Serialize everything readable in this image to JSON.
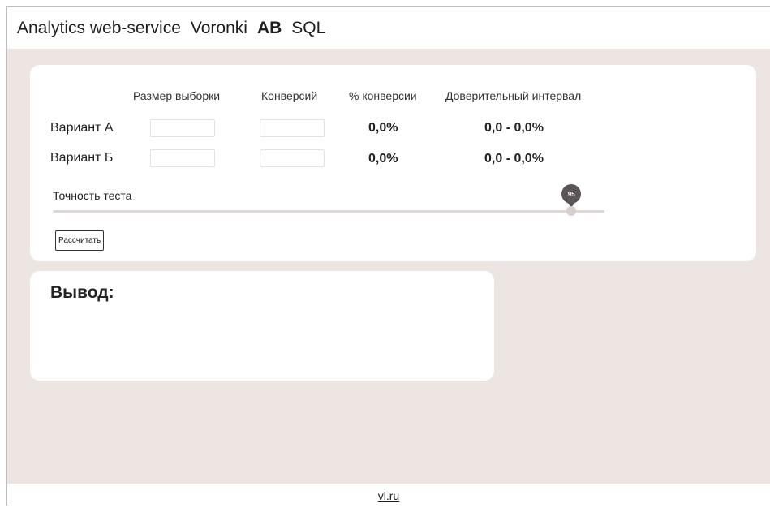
{
  "nav": {
    "brand": "Analytics web-service",
    "items": [
      {
        "label": "Voronki",
        "active": false
      },
      {
        "label": "AB",
        "active": true
      },
      {
        "label": "SQL",
        "active": false
      }
    ]
  },
  "ab_form": {
    "headers": {
      "sample_size": "Размер выборки",
      "conversions": "Конверсий",
      "conversion_pct": "% конверсии",
      "confidence_interval": "Доверительный интервал"
    },
    "variants": [
      {
        "label": "Вариант А",
        "sample_size": "",
        "conversions": "",
        "conversion_pct": "0,0%",
        "interval": "0,0 - 0,0%"
      },
      {
        "label": "Вариант Б",
        "sample_size": "",
        "conversions": "",
        "conversion_pct": "0,0%",
        "interval": "0,0 - 0,0%"
      }
    ],
    "accuracy": {
      "label": "Точность теста",
      "value": "95",
      "slider_fraction": 0.94
    },
    "calculate_label": "Рассчитать"
  },
  "output": {
    "title": "Вывод:"
  },
  "footer": {
    "link": "vl.ru"
  }
}
